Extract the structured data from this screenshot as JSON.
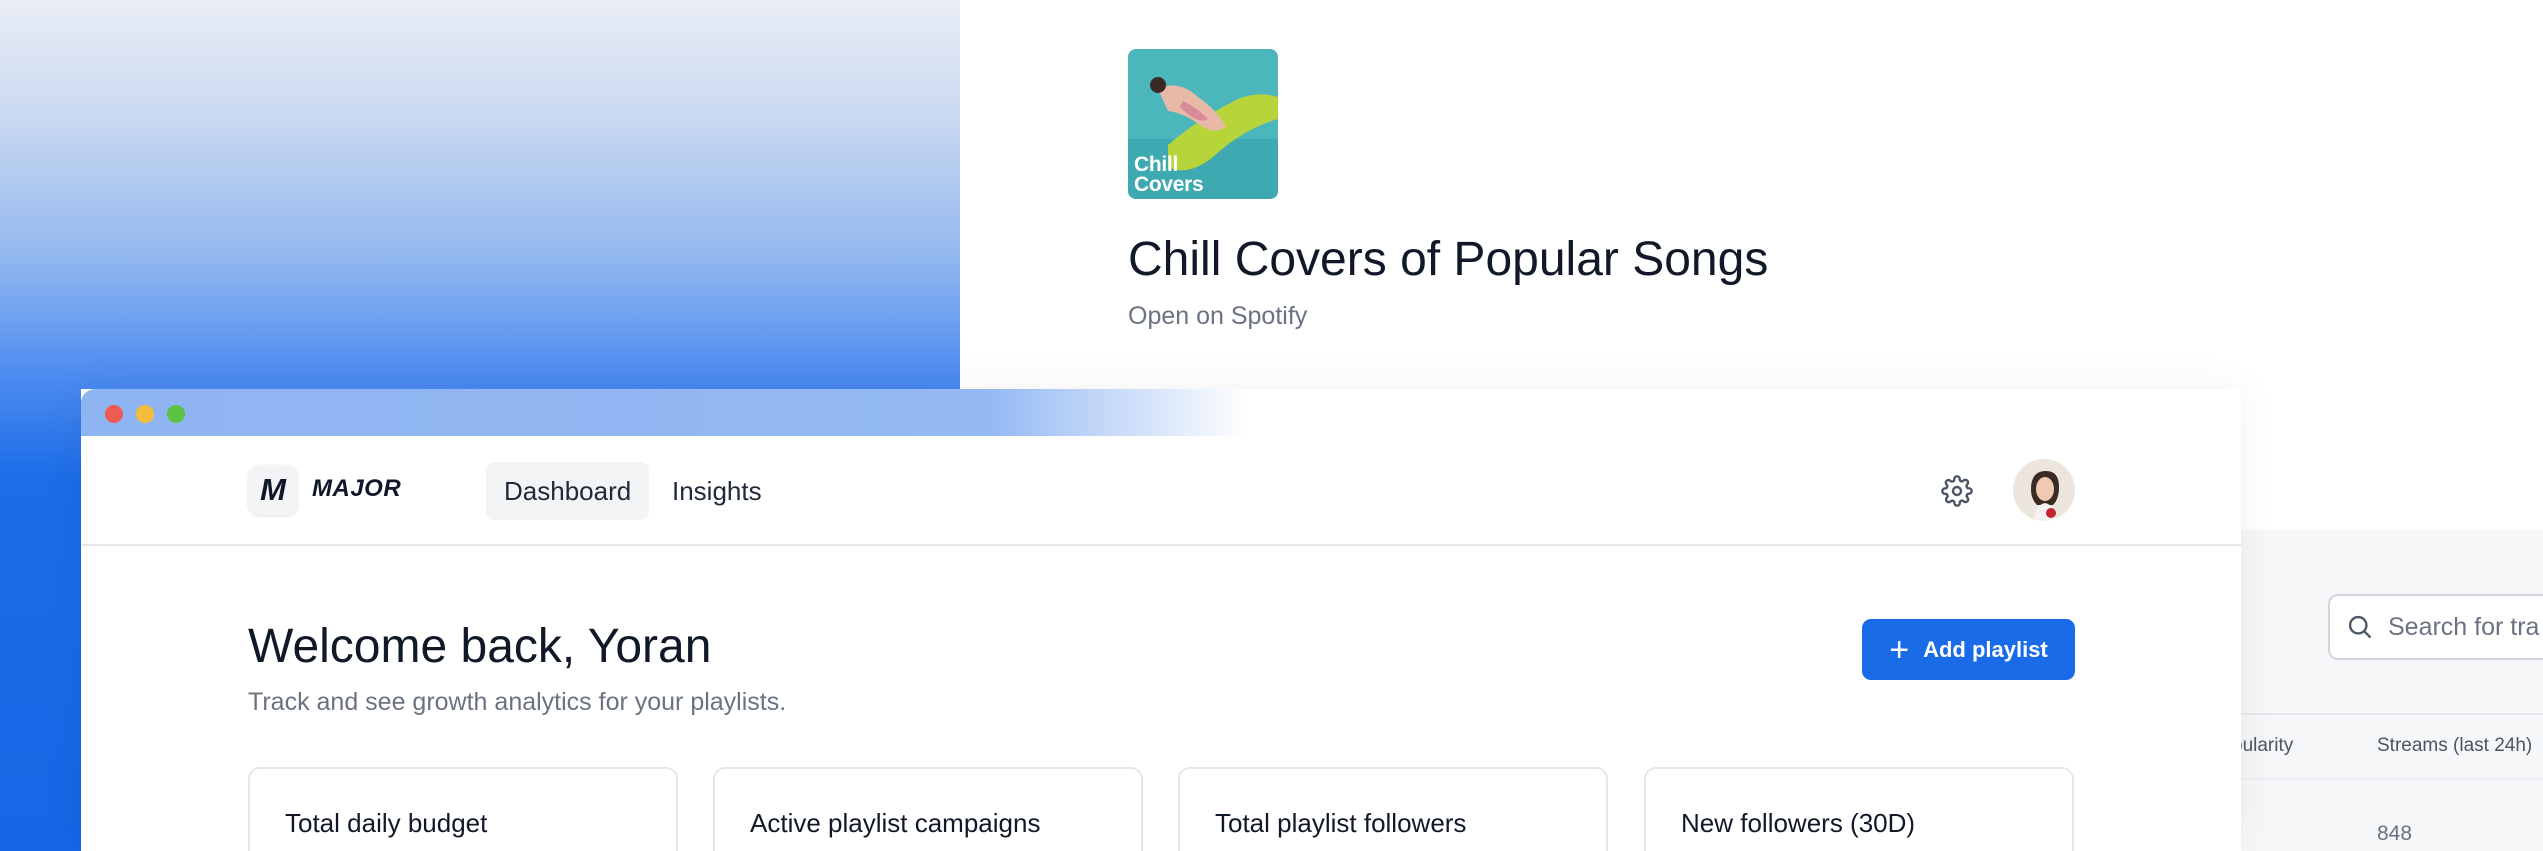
{
  "background_page": {
    "cover": {
      "label_line1": "Chill",
      "label_line2": "Covers"
    },
    "title": "Chill Covers of Popular Songs",
    "link": "Open on Spotify",
    "search_placeholder": "Search for tra",
    "table": {
      "headers": [
        "pularity",
        "Streams (last 24h)"
      ],
      "rows": [
        {
          "streams": "848"
        }
      ]
    }
  },
  "app": {
    "logo_letter": "M",
    "brand": "MAJOR",
    "nav": {
      "tabs": [
        {
          "label": "Dashboard",
          "active": true
        },
        {
          "label": "Insights",
          "active": false
        }
      ]
    },
    "header": {
      "title": "Welcome back, Yoran",
      "subtitle": "Track and see growth analytics for your playlists.",
      "add_button_label": "Add playlist"
    },
    "stats": [
      {
        "label": "Total daily budget"
      },
      {
        "label": "Active playlist campaigns"
      },
      {
        "label": "Total playlist followers"
      },
      {
        "label": "New followers (30D)"
      }
    ]
  },
  "icons": {
    "settings": "gear-icon",
    "search": "search-icon",
    "add": "plus-icon",
    "window_controls": [
      "close-dot",
      "minimize-dot",
      "zoom-dot"
    ]
  },
  "colors": {
    "accent": "#1a6be8",
    "window_close": "#ee5b52",
    "window_minimize": "#f3bc3a",
    "window_zoom": "#5bc445"
  }
}
